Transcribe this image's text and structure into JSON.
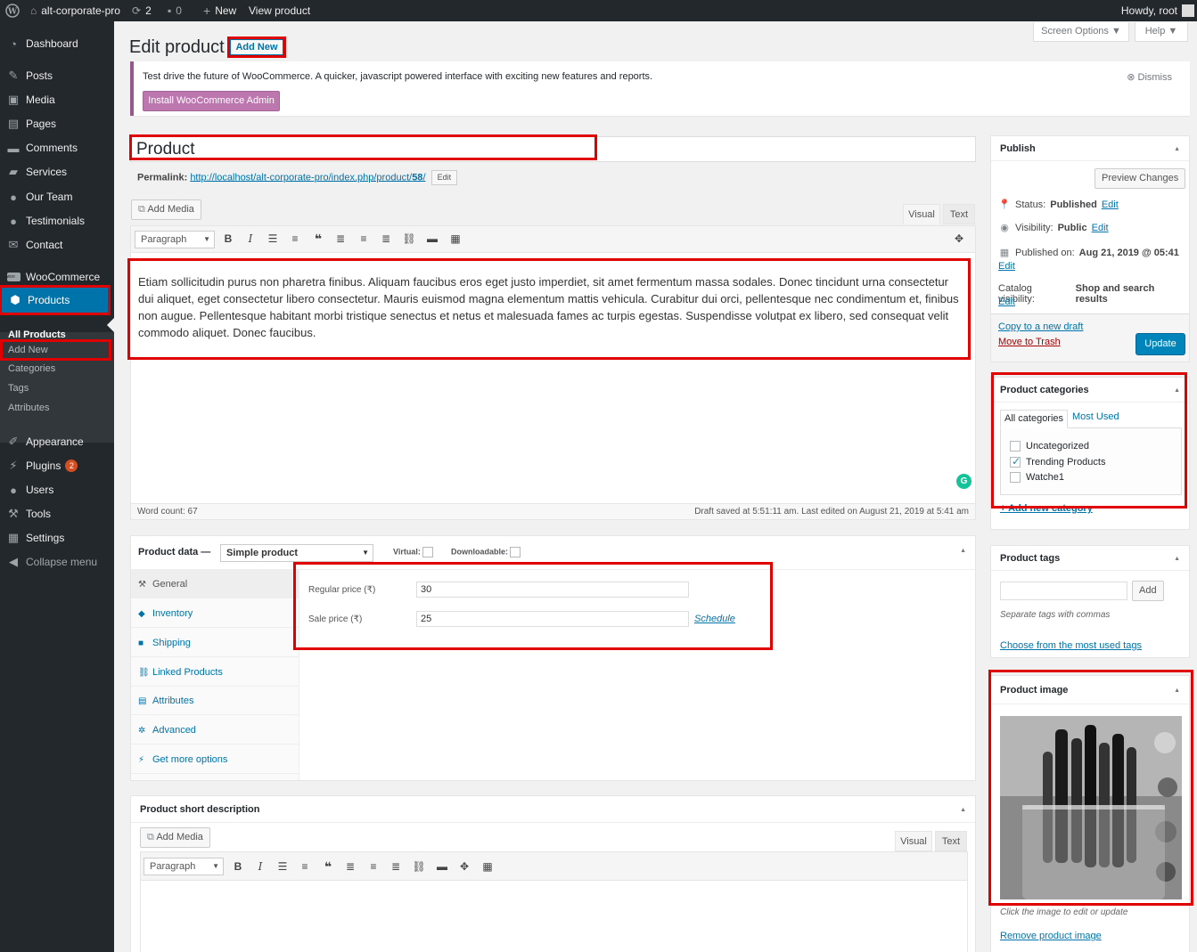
{
  "adminbar": {
    "site_name": "alt-corporate-pro",
    "updates_count": "2",
    "comments_count": "0",
    "new_label": "New",
    "view_label": "View product",
    "howdy": "Howdy, root"
  },
  "sidebar": {
    "items": [
      {
        "label": "Dashboard"
      },
      {
        "label": "Posts"
      },
      {
        "label": "Media"
      },
      {
        "label": "Pages"
      },
      {
        "label": "Comments"
      },
      {
        "label": "Services"
      },
      {
        "label": "Our Team"
      },
      {
        "label": "Testimonials"
      },
      {
        "label": "Contact"
      },
      {
        "label": "WooCommerce"
      },
      {
        "label": "Products"
      },
      {
        "label": "Appearance"
      },
      {
        "label": "Plugins",
        "badge": "2"
      },
      {
        "label": "Users"
      },
      {
        "label": "Tools"
      },
      {
        "label": "Settings"
      },
      {
        "label": "Collapse menu"
      }
    ],
    "submenu": [
      "All Products",
      "Add New",
      "Categories",
      "Tags",
      "Attributes"
    ]
  },
  "header": {
    "title": "Edit product",
    "add_new": "Add New",
    "screen_options": "Screen Options ▼",
    "help": "Help ▼"
  },
  "notice": {
    "text": "Test drive the future of WooCommerce. A quicker, javascript powered interface with exciting new features and reports.",
    "button": "Install WooCommerce Admin",
    "dismiss": "Dismiss"
  },
  "post": {
    "title": "Product",
    "permalink_label": "Permalink:",
    "permalink_url": "http://localhost/alt-corporate-pro/index.php/product/",
    "permalink_slug": "58",
    "permalink_suffix": "/",
    "edit_label": "Edit"
  },
  "editor": {
    "add_media": "Add Media",
    "tab_visual": "Visual",
    "tab_text": "Text",
    "format": "Paragraph",
    "content": "Etiam sollicitudin purus non pharetra finibus. Aliquam faucibus eros eget justo imperdiet, sit amet fermentum massa sodales. Donec tincidunt urna consectetur dui aliquet, eget consectetur libero consectetur. Mauris euismod magna elementum mattis vehicula. Curabitur dui orci, pellentesque nec condimentum et, finibus non augue. Pellentesque habitant morbi tristique senectus et netus et malesuada fames ac turpis egestas. Suspendisse volutpat ex libero, sed consequat velit commodo aliquet. Donec faucibus.",
    "word_count": "Word count: 67",
    "draft_saved": "Draft saved at 5:51:11 am. Last edited on August 21, 2019 at 5:41 am"
  },
  "product_data": {
    "label": "Product data —",
    "type": "Simple product",
    "virtual": "Virtual:",
    "downloadable": "Downloadable:",
    "tabs": [
      "General",
      "Inventory",
      "Shipping",
      "Linked Products",
      "Attributes",
      "Advanced",
      "Get more options"
    ],
    "regular_price_label": "Regular price (₹)",
    "regular_price": "30",
    "sale_price_label": "Sale price (₹)",
    "sale_price": "25",
    "schedule": "Schedule"
  },
  "short_description": {
    "title": "Product short description",
    "add_media": "Add Media",
    "tab_visual": "Visual",
    "tab_text": "Text",
    "format": "Paragraph"
  },
  "publish": {
    "title": "Publish",
    "preview": "Preview Changes",
    "status_label": "Status:",
    "status_value": "Published",
    "visibility_label": "Visibility:",
    "visibility_value": "Public",
    "published_label": "Published on:",
    "published_value": "Aug 21, 2019 @ 05:41",
    "catalog_label": "Catalog visibility:",
    "catalog_value": "Shop and search results",
    "edit": "Edit",
    "copy_draft": "Copy to a new draft",
    "trash": "Move to Trash",
    "update": "Update"
  },
  "categories": {
    "title": "Product categories",
    "tab_all": "All categories",
    "tab_most": "Most Used",
    "items": [
      {
        "label": "Uncategorized",
        "checked": false
      },
      {
        "label": "Trending Products",
        "checked": true
      },
      {
        "label": "Watche1",
        "checked": false
      }
    ],
    "add_new": "+ Add new category"
  },
  "tags": {
    "title": "Product tags",
    "add": "Add",
    "hint": "Separate tags with commas",
    "choose": "Choose from the most used tags"
  },
  "product_image": {
    "title": "Product image",
    "hint": "Click the image to edit or update",
    "remove": "Remove product image"
  },
  "colors": {
    "admin_dark": "#23282d",
    "accent": "#0073aa",
    "woo": "#96588a",
    "highlight": "#e00000"
  }
}
